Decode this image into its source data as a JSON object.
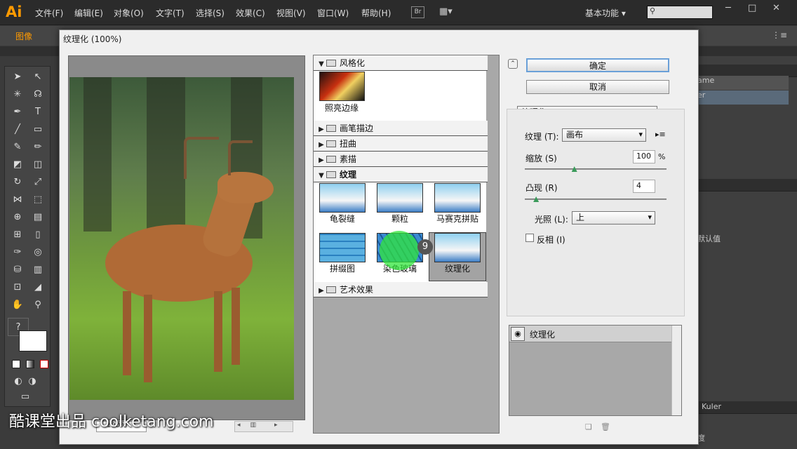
{
  "app": {
    "logo": "Ai"
  },
  "menubar": {
    "items": [
      "文件(F)",
      "编辑(E)",
      "对象(O)",
      "文字(T)",
      "选择(S)",
      "效果(C)",
      "视图(V)",
      "窗口(W)",
      "帮助(H)"
    ],
    "br_label": "Br",
    "workspace": "基本功能",
    "window_buttons": [
      "─",
      "□",
      "✕"
    ]
  },
  "controlbar": {
    "label": "图像"
  },
  "dialog": {
    "title": "纹理化 (100%)",
    "preview": {
      "zoom": "100%"
    },
    "gallery": {
      "categories": {
        "stylize": "风格化",
        "brush": "画笔描边",
        "distort": "扭曲",
        "sketch": "素描",
        "texture": "纹理",
        "artistic": "艺术效果"
      },
      "stylize_thumbs": [
        "照亮边缘"
      ],
      "texture_thumbs": [
        "龟裂缝",
        "颗粒",
        "马赛克拼贴",
        "拼缀图",
        "染色玻璃",
        "纹理化"
      ],
      "selected": "纹理化"
    },
    "buttons": {
      "ok": "确定",
      "cancel": "取消"
    },
    "settings": {
      "filter_select": "纹理化",
      "texture_label": "纹理 (T):",
      "texture_value": "画布",
      "scaling_label": "缩放 (S)",
      "scaling_value": "100",
      "scaling_unit": "%",
      "scaling_level": 0.35,
      "relief_label": "凸现 (R)",
      "relief_value": "4",
      "relief_level": 0.08,
      "light_label": "光照 (L):",
      "light_value": "上",
      "invert_label": "反相 (I)"
    },
    "layers": [
      {
        "name": "纹理化"
      }
    ]
  },
  "right_panel": {
    "rows": [
      "ame",
      "er",
      "默认值",
      "Kuler",
      "度"
    ]
  },
  "cursor": {
    "badge": "9"
  },
  "watermark": "酷课堂出品 coolketang.com",
  "colors": {
    "accent": "#ff9a00",
    "ok_border": "#6aa0d8"
  }
}
